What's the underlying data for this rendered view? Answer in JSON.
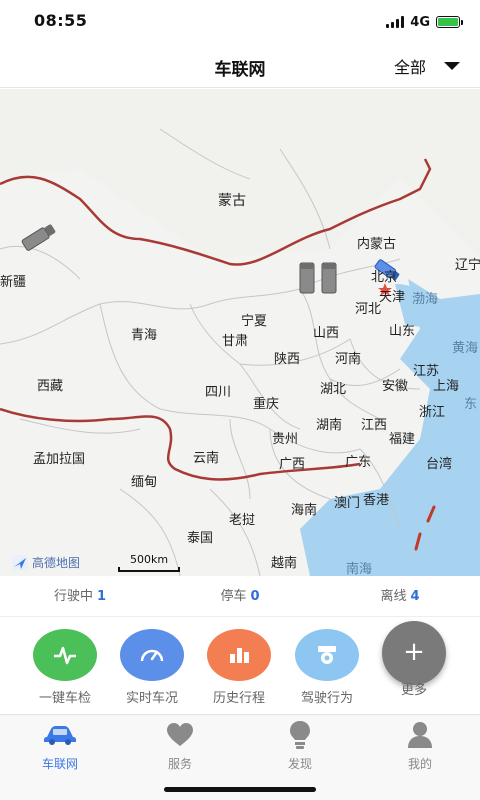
{
  "status_bar": {
    "time": "08:55",
    "network": "4G"
  },
  "header": {
    "title": "车联网",
    "filter_label": "全部"
  },
  "map": {
    "labels": {
      "mongolia": "蒙古",
      "inner_mongolia": "内蒙古",
      "xinjiang": "新疆",
      "beijing": "北京",
      "tianjin": "天津",
      "liaoning": "辽宁",
      "hebei": "河北",
      "bohai": "渤海",
      "ningxia": "宁夏",
      "qinghai": "青海",
      "gansu": "甘肃",
      "shanxi": "山西",
      "shandong": "山东",
      "shaanxi": "陕西",
      "henan": "河南",
      "jiangsu": "江苏",
      "yellow_sea": "黄海",
      "tibet": "西藏",
      "sichuan": "四川",
      "hubei": "湖北",
      "anhui": "安徽",
      "shanghai": "上海",
      "east_sea": "东",
      "chongqing": "重庆",
      "zhejiang": "浙江",
      "hunan": "湖南",
      "jiangxi": "江西",
      "guizhou": "贵州",
      "fujian": "福建",
      "bangladesh": "孟加拉国",
      "yunnan": "云南",
      "guangxi": "广西",
      "guangdong": "广东",
      "taiwan": "台湾",
      "myanmar": "缅甸",
      "macau": "澳门",
      "hongkong": "香港",
      "hainan": "海南",
      "laos": "老挝",
      "thailand": "泰国",
      "vietnam": "越南",
      "south_sea": "南海"
    },
    "logo_text": "高德地图",
    "scale_text": "500km"
  },
  "vehicle_status": {
    "moving_label": "行驶中",
    "moving_count": "1",
    "parked_label": "停车",
    "parked_count": "0",
    "offline_label": "离线",
    "offline_count": "4"
  },
  "actions": {
    "inspect": "一键车检",
    "realtime": "实时车况",
    "history": "历史行程",
    "behavior": "驾驶行为",
    "more": "更多",
    "plus": "+"
  },
  "colors": {
    "inspect": "#4cc058",
    "realtime": "#5b8fe8",
    "history": "#f27e52",
    "behavior": "#8ec6f2",
    "more": "#7a7a7a",
    "accent": "#3b78e7",
    "border_line": "#a83a36",
    "sea": "#a8d3f0"
  },
  "tabs": {
    "carnet": "车联网",
    "service": "服务",
    "discover": "发现",
    "mine": "我的"
  }
}
